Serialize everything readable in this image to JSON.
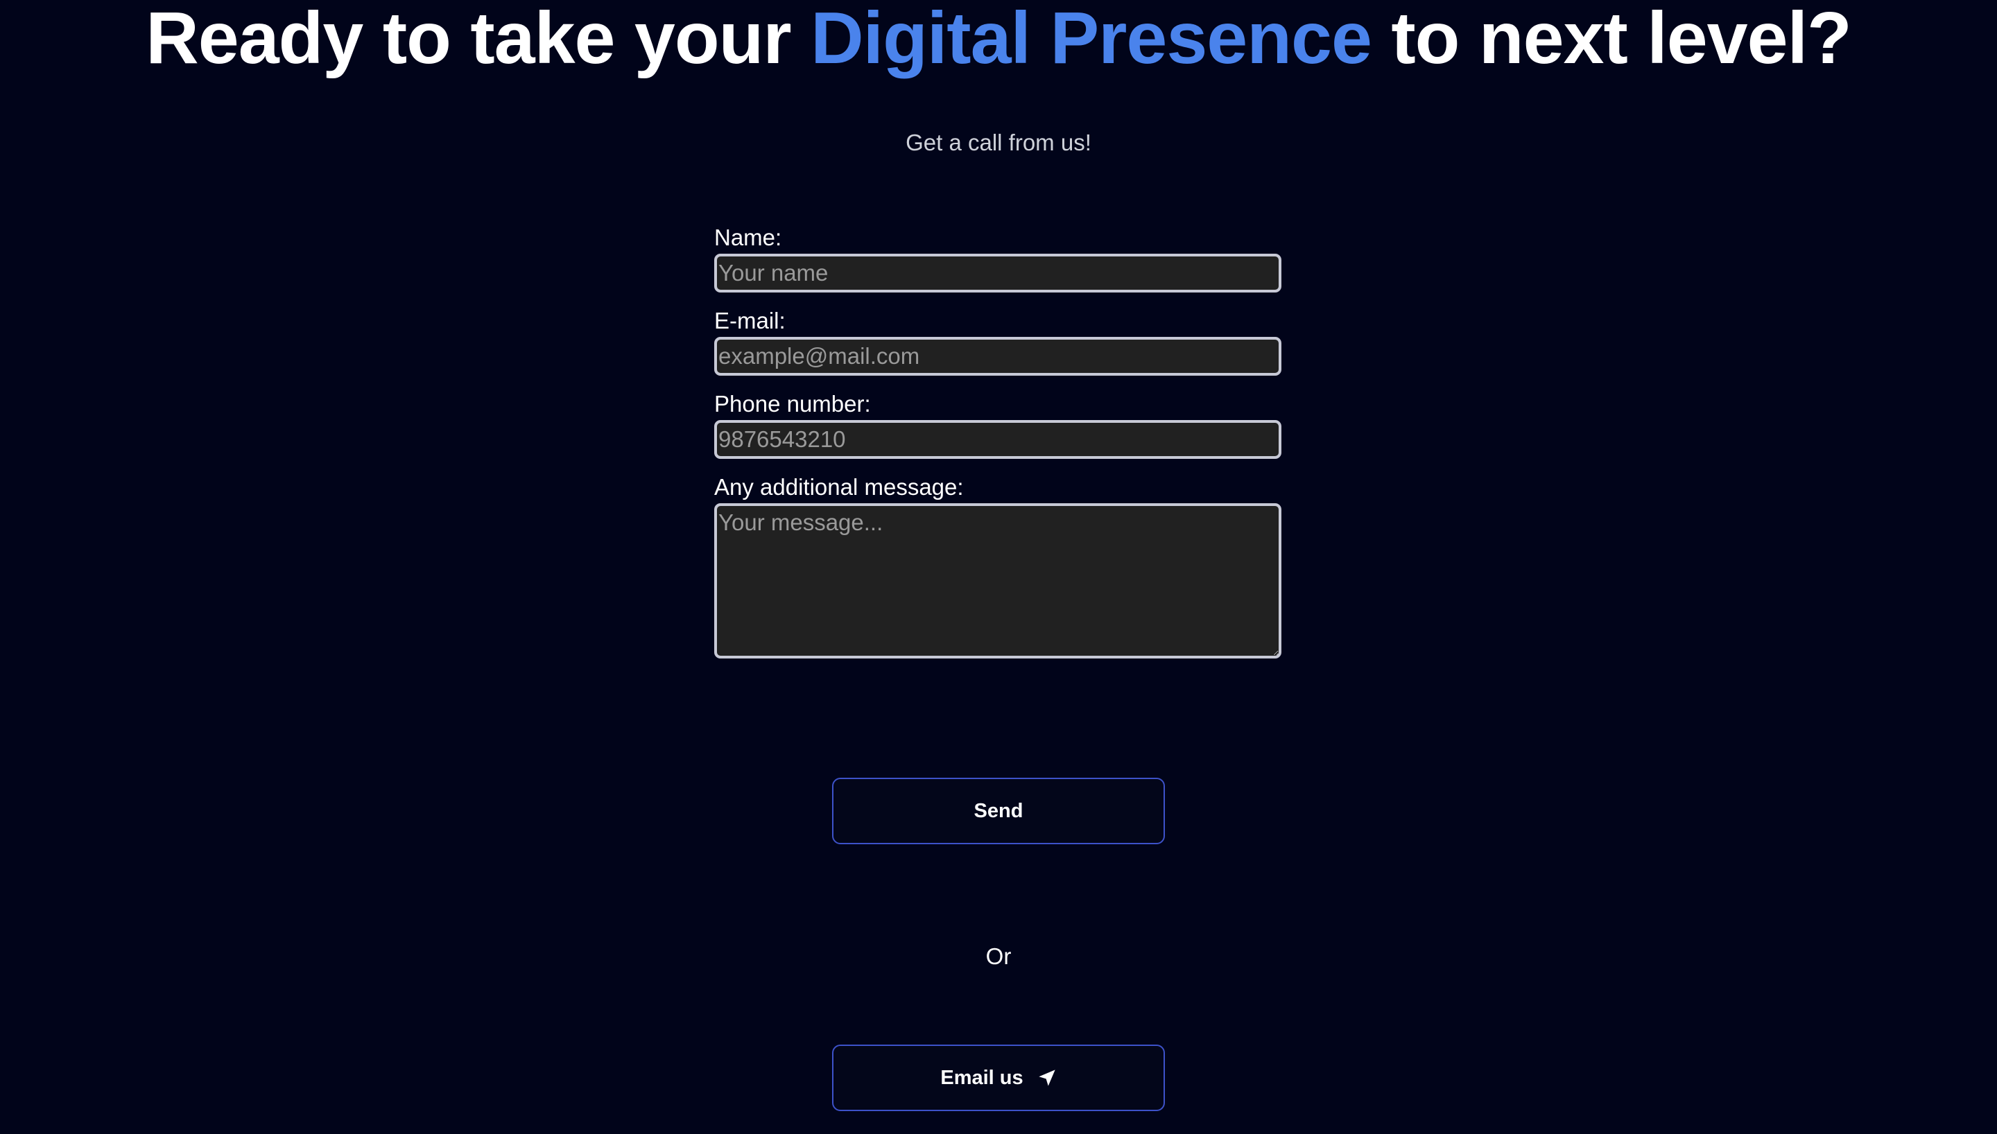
{
  "headline": {
    "prefix": "Ready to take your ",
    "highlight": "Digital Presence",
    "suffix": " to next level?"
  },
  "subtitle": "Get a call from us!",
  "form": {
    "name": {
      "label": "Name:",
      "placeholder": "Your name",
      "value": ""
    },
    "email": {
      "label": "E-mail:",
      "placeholder": "example@mail.com",
      "value": ""
    },
    "phone": {
      "label": "Phone number:",
      "placeholder": "9876543210",
      "value": ""
    },
    "message": {
      "label": "Any additional message:",
      "placeholder": "Your message...",
      "value": ""
    }
  },
  "send_button": {
    "label": "Send"
  },
  "separator": "Or",
  "email_button": {
    "label": "Email us",
    "icon": "send-icon"
  },
  "colors": {
    "background": "#01041a",
    "accent": "#4a83ec",
    "button_border": "#3d52c9",
    "field_background": "#212121",
    "field_border": "#c7c9d6"
  }
}
